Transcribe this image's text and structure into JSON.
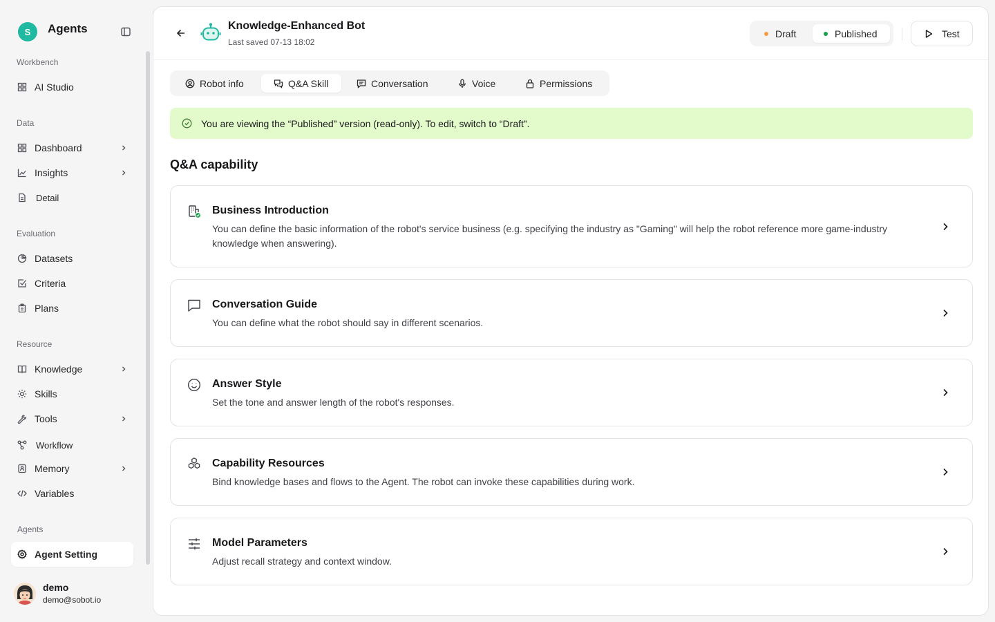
{
  "sidebar": {
    "brand_initial": "S",
    "brand_name": "Agents",
    "sections": {
      "workbench": "Workbench",
      "data": "Data",
      "evaluation": "Evaluation",
      "resource": "Resource",
      "agents": "Agents"
    },
    "items": {
      "ai_studio": "AI Studio",
      "dashboard": "Dashboard",
      "insights": "Insights",
      "detail": "Detail",
      "datasets": "Datasets",
      "criteria": "Criteria",
      "plans": "Plans",
      "knowledge": "Knowledge",
      "skills": "Skills",
      "tools": "Tools",
      "workflow": "Workflow",
      "memory": "Memory",
      "variables": "Variables",
      "agent_setting": "Agent Setting"
    },
    "user": {
      "name": "demo",
      "email": "demo@sobot.io"
    }
  },
  "header": {
    "title": "Knowledge-Enhanced Bot",
    "last_saved": "Last saved 07-13 18:02",
    "version_draft": "Draft",
    "version_published": "Published",
    "selected_version": "Published",
    "test_label": "Test",
    "draft_color": "#f59e42",
    "published_color": "#16a34a"
  },
  "tabs": {
    "robot_info": "Robot info",
    "qa_skill": "Q&A Skill",
    "conversation": "Conversation",
    "voice": "Voice",
    "permissions": "Permissions",
    "active": "Q&A Skill"
  },
  "banner": {
    "text": "You are viewing the “Published” version (read-only). To edit, switch to “Draft”."
  },
  "section_title": "Q&A capability",
  "cards": [
    {
      "title": "Business Introduction",
      "description": "You can define the basic information of the robot's service business (e.g. specifying the industry as \"Gaming\" will help the robot reference more game-industry knowledge when answering)."
    },
    {
      "title": "Conversation Guide",
      "description": "You can define what the robot should say in different scenarios."
    },
    {
      "title": "Answer Style",
      "description": "Set the tone and answer length of the robot's responses."
    },
    {
      "title": "Capability Resources",
      "description": "Bind knowledge bases and flows to the Agent. The robot can invoke these capabilities during work."
    },
    {
      "title": "Model Parameters",
      "description": "Adjust recall strategy and context window."
    }
  ],
  "colors": {
    "accent": "#1fb8a0",
    "banner_bg": "#e3fbcb"
  }
}
